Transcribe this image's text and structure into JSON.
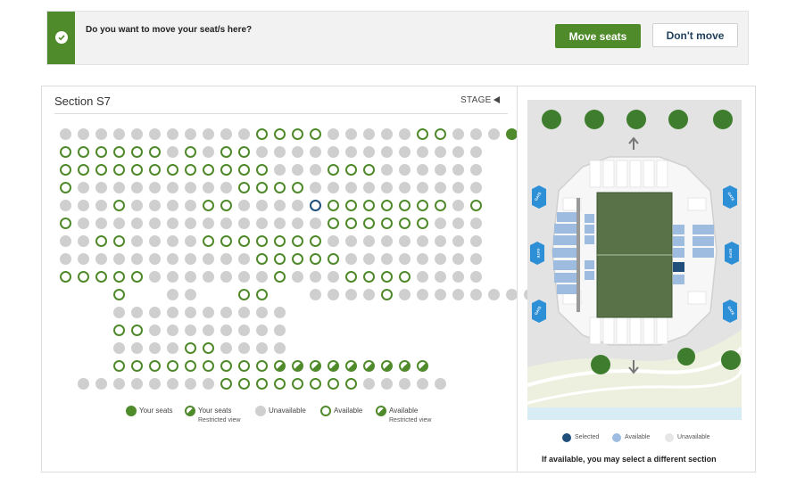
{
  "banner": {
    "question": "Do you want to move your seat/s here?",
    "move_label": "Move seats",
    "dont_move_label": "Don't move"
  },
  "section": {
    "title": "Section S7",
    "stage_label": "STAGE"
  },
  "seat_rows": [
    {
      "start": 0,
      "seats": "uuuuuuuuuuuaaaauuuuuaauuuy"
    },
    {
      "start": 0,
      "seats": "aaaaaauauaauuuuuuuuuuuuu"
    },
    {
      "start": 0,
      "seats": "aaaaaaaaaaaauuuaaauuuuuu"
    },
    {
      "start": 0,
      "seats": "auuuuuuuuuaaaauuuuuuuuuu"
    },
    {
      "start": 0,
      "seats": "uuuauuuuaauuuusaaaaaaaua"
    },
    {
      "start": 0,
      "seats": "auuuuuuuuuuuuuuaaaaaauuu"
    },
    {
      "start": 0,
      "seats": "uuaauuuuaaaaaaauuuuuuuuu"
    },
    {
      "start": 0,
      "seats": "uuuuuuuuuuuaaaaauuuuuuuu"
    },
    {
      "start": 0,
      "seats": "aaaaauuuuuuuauuuaaaauuuu"
    },
    {
      "start": 3,
      "seats": "a..uu..aa..uuuuauuuuuuuu"
    },
    {
      "start": 3,
      "seats": "uuuuuuuuuu"
    },
    {
      "start": 3,
      "seats": "aauuuuuuuu"
    },
    {
      "start": 3,
      "seats": "uuuuaauuuu"
    },
    {
      "start": 3,
      "seats": "aaaaaaaaarrrrrrrrr"
    },
    {
      "start": 1,
      "seats": "uuuuuuuuaaaaaaaauuuuu"
    }
  ],
  "legend": [
    {
      "key": "y",
      "label": "Your seats",
      "sub": ""
    },
    {
      "key": "r",
      "label": "Your seats",
      "sub": "Restricted view"
    },
    {
      "key": "u",
      "label": "Unavailable",
      "sub": ""
    },
    {
      "key": "a",
      "label": "Available",
      "sub": ""
    },
    {
      "key": "r",
      "label": "Available",
      "sub": "Restricted view"
    }
  ],
  "venue": {
    "gate_label": "GATE",
    "legend": [
      {
        "label": "Selected",
        "color": "#1f4f7a"
      },
      {
        "label": "Available",
        "color": "#9dbce0"
      },
      {
        "label": "Unavailable",
        "color": "#e6e6e6"
      }
    ],
    "note": "If available, you may select a different section"
  },
  "colors": {
    "accent_green": "#4f8a2b",
    "selected_blue": "#1f4f7a",
    "unavailable_grey": "#cfcfcf",
    "gate_blue": "#2d8fd6",
    "available_section_blue": "#9dbce0"
  }
}
